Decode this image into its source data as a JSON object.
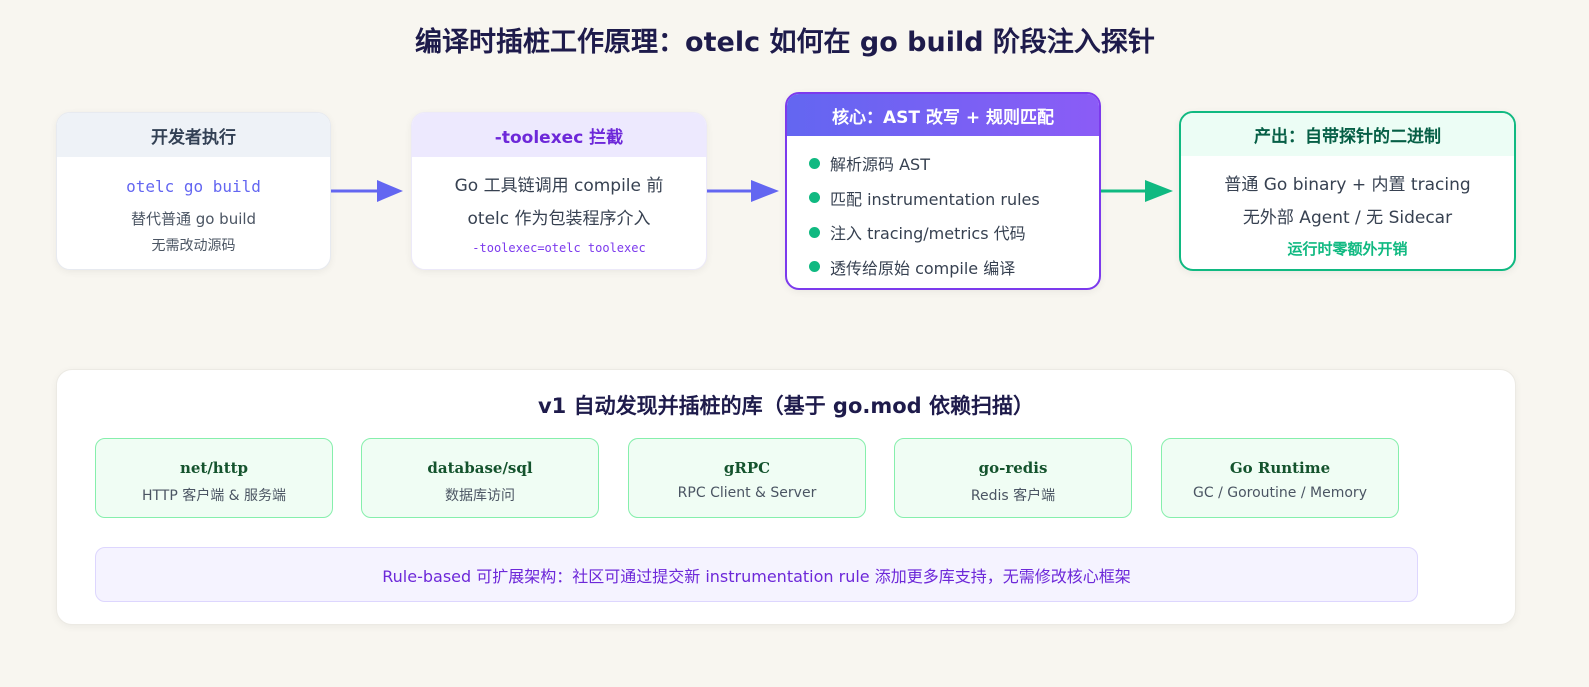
{
  "title": "编译时插桩工作原理：otelc 如何在 go build 阶段注入探针",
  "flow": {
    "developer": {
      "header": "开发者执行",
      "command": "otelc go build",
      "line1": "替代普通 go build",
      "line2": "无需改动源码"
    },
    "toolexec": {
      "header": "-toolexec 拦截",
      "line1": "Go 工具链调用 compile 前",
      "line2": "otelc 作为包装程序介入",
      "flag": "-toolexec=otelc toolexec"
    },
    "core": {
      "header": "核心：AST 改写 + 规则匹配",
      "items": [
        "解析源码 AST",
        "匹配 instrumentation rules",
        "注入 tracing/metrics 代码",
        "透传给原始 compile 编译"
      ]
    },
    "output": {
      "header": "产出：自带探针的二进制",
      "line1": "普通 Go binary + 内置 tracing",
      "line2": "无外部 Agent / 无 Sidecar",
      "note": "运行时零额外开销"
    }
  },
  "libraries": {
    "title": "v1 自动发现并插桩的库（基于 go.mod 依赖扫描）",
    "items": [
      {
        "name": "net/http",
        "desc": "HTTP 客户端 & 服务端"
      },
      {
        "name": "database/sql",
        "desc": "数据库访问"
      },
      {
        "name": "gRPC",
        "desc": "RPC Client & Server"
      },
      {
        "name": "go-redis",
        "desc": "Redis 客户端"
      },
      {
        "name": "Go Runtime",
        "desc": "GC / Goroutine / Memory"
      }
    ],
    "note": "Rule-based 可扩展架构：社区可通过提交新 instrumentation rule 添加更多库支持，无需修改核心框架"
  },
  "colors": {
    "accent_purple": "#6366f1",
    "accent_green": "#10b981",
    "title": "#1e1b4b"
  }
}
